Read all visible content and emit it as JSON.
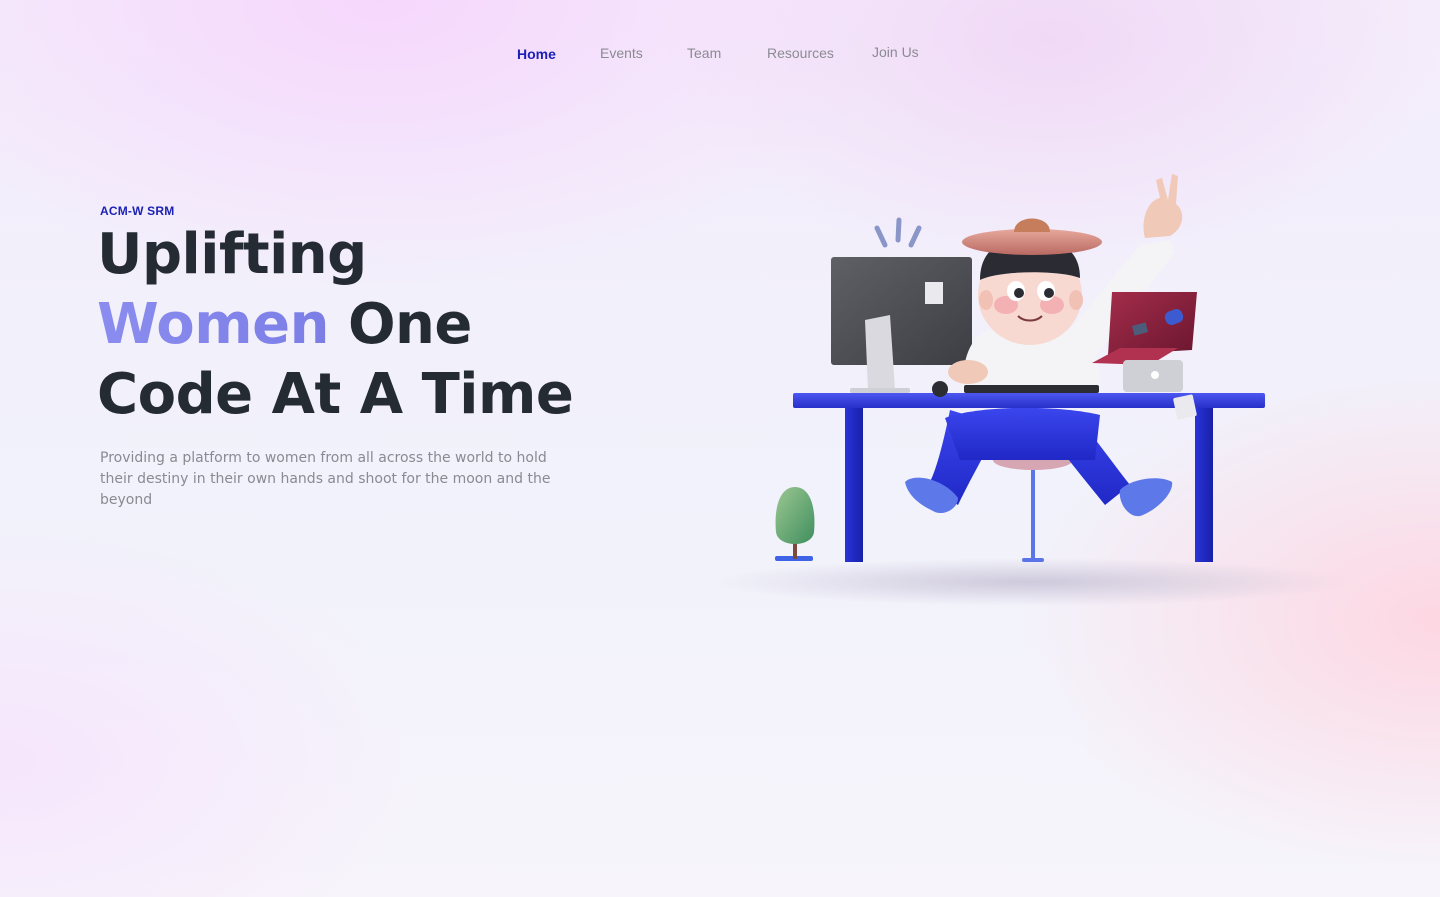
{
  "nav": {
    "items": [
      {
        "label": "Home",
        "active": true
      },
      {
        "label": "Events",
        "active": false
      },
      {
        "label": "Team",
        "active": false
      },
      {
        "label": "Resources",
        "active": false
      },
      {
        "label": "Join Us",
        "active": false
      }
    ]
  },
  "hero": {
    "eyebrow": "ACM-W SRM",
    "headline": {
      "line1": "Uplifting",
      "accent": "Women",
      "line2_rest": "One",
      "line3": "Code At A Time"
    },
    "subtext": "Providing a platform to women from all across the world to hold their destiny in their own hands and shoot for the moon and the beyond"
  },
  "illustration": {
    "icon": "person-at-desk-illustration"
  },
  "colors": {
    "nav_active": "#1a1fb8",
    "nav_inactive": "#8b8b93",
    "eyebrow": "#1c23b3",
    "headline": "#252b33",
    "accent": "#7b7ee6",
    "subtext": "#8a8a92",
    "desk": "#2b35d6"
  }
}
